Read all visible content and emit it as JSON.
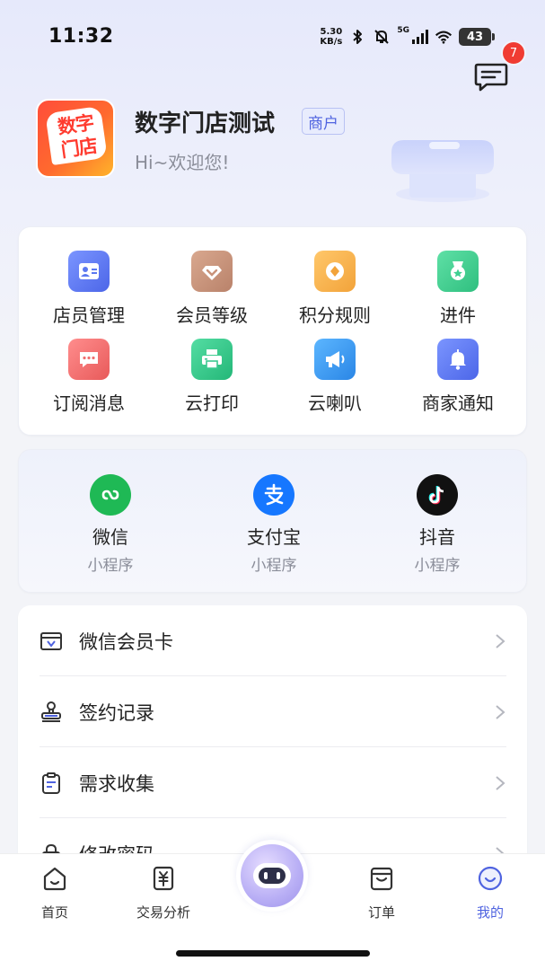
{
  "status_bar": {
    "time": "11:32",
    "speed_value": "5.30",
    "speed_unit": "KB/s",
    "network": "5G",
    "battery": "43"
  },
  "header": {
    "message_badge_count": "7",
    "store_logo_text": "数字门店",
    "store_name": "数字门店测试",
    "role_tag": "商户",
    "greeting": "Hi~欢迎您!"
  },
  "quick_menu": [
    {
      "label": "店员管理",
      "icon": "staff-card-icon",
      "color": "#5b78f0"
    },
    {
      "label": "会员等级",
      "icon": "diamond-icon",
      "color": "#c9937a"
    },
    {
      "label": "积分规则",
      "icon": "coin-icon",
      "color": "#f6b34b"
    },
    {
      "label": "进件",
      "icon": "medal-icon",
      "color": "#3fcf92"
    },
    {
      "label": "订阅消息",
      "icon": "message-icon",
      "color": "#f06f6f"
    },
    {
      "label": "云打印",
      "icon": "printer-icon",
      "color": "#3bc891"
    },
    {
      "label": "云喇叭",
      "icon": "megaphone-icon",
      "color": "#3a9cf0"
    },
    {
      "label": "商家通知",
      "icon": "bell-icon",
      "color": "#5b78f0"
    }
  ],
  "mini_programs": [
    {
      "name": "微信",
      "sub": "小程序",
      "icon": "wechat-miniprogram-icon",
      "color": "#1fb955"
    },
    {
      "name": "支付宝",
      "sub": "小程序",
      "icon": "alipay-icon",
      "color": "#1677ff"
    },
    {
      "name": "抖音",
      "sub": "小程序",
      "icon": "douyin-icon",
      "color": "#111111"
    }
  ],
  "settings_list": [
    {
      "label": "微信会员卡",
      "icon": "member-card-icon"
    },
    {
      "label": "签约记录",
      "icon": "stamp-icon"
    },
    {
      "label": "需求收集",
      "icon": "clipboard-icon"
    },
    {
      "label": "修改密码",
      "icon": "lock-icon"
    }
  ],
  "bottom_nav": [
    {
      "label": "首页",
      "icon": "home-icon",
      "active": false
    },
    {
      "label": "交易分析",
      "icon": "yuan-receipt-icon",
      "active": false
    },
    {
      "label": "",
      "icon": "ai-robot-icon",
      "active": false
    },
    {
      "label": "订单",
      "icon": "order-bag-icon",
      "active": false
    },
    {
      "label": "我的",
      "icon": "smile-profile-icon",
      "active": true
    }
  ],
  "colors": {
    "accent": "#4f63e0",
    "badge": "#f03c32"
  }
}
